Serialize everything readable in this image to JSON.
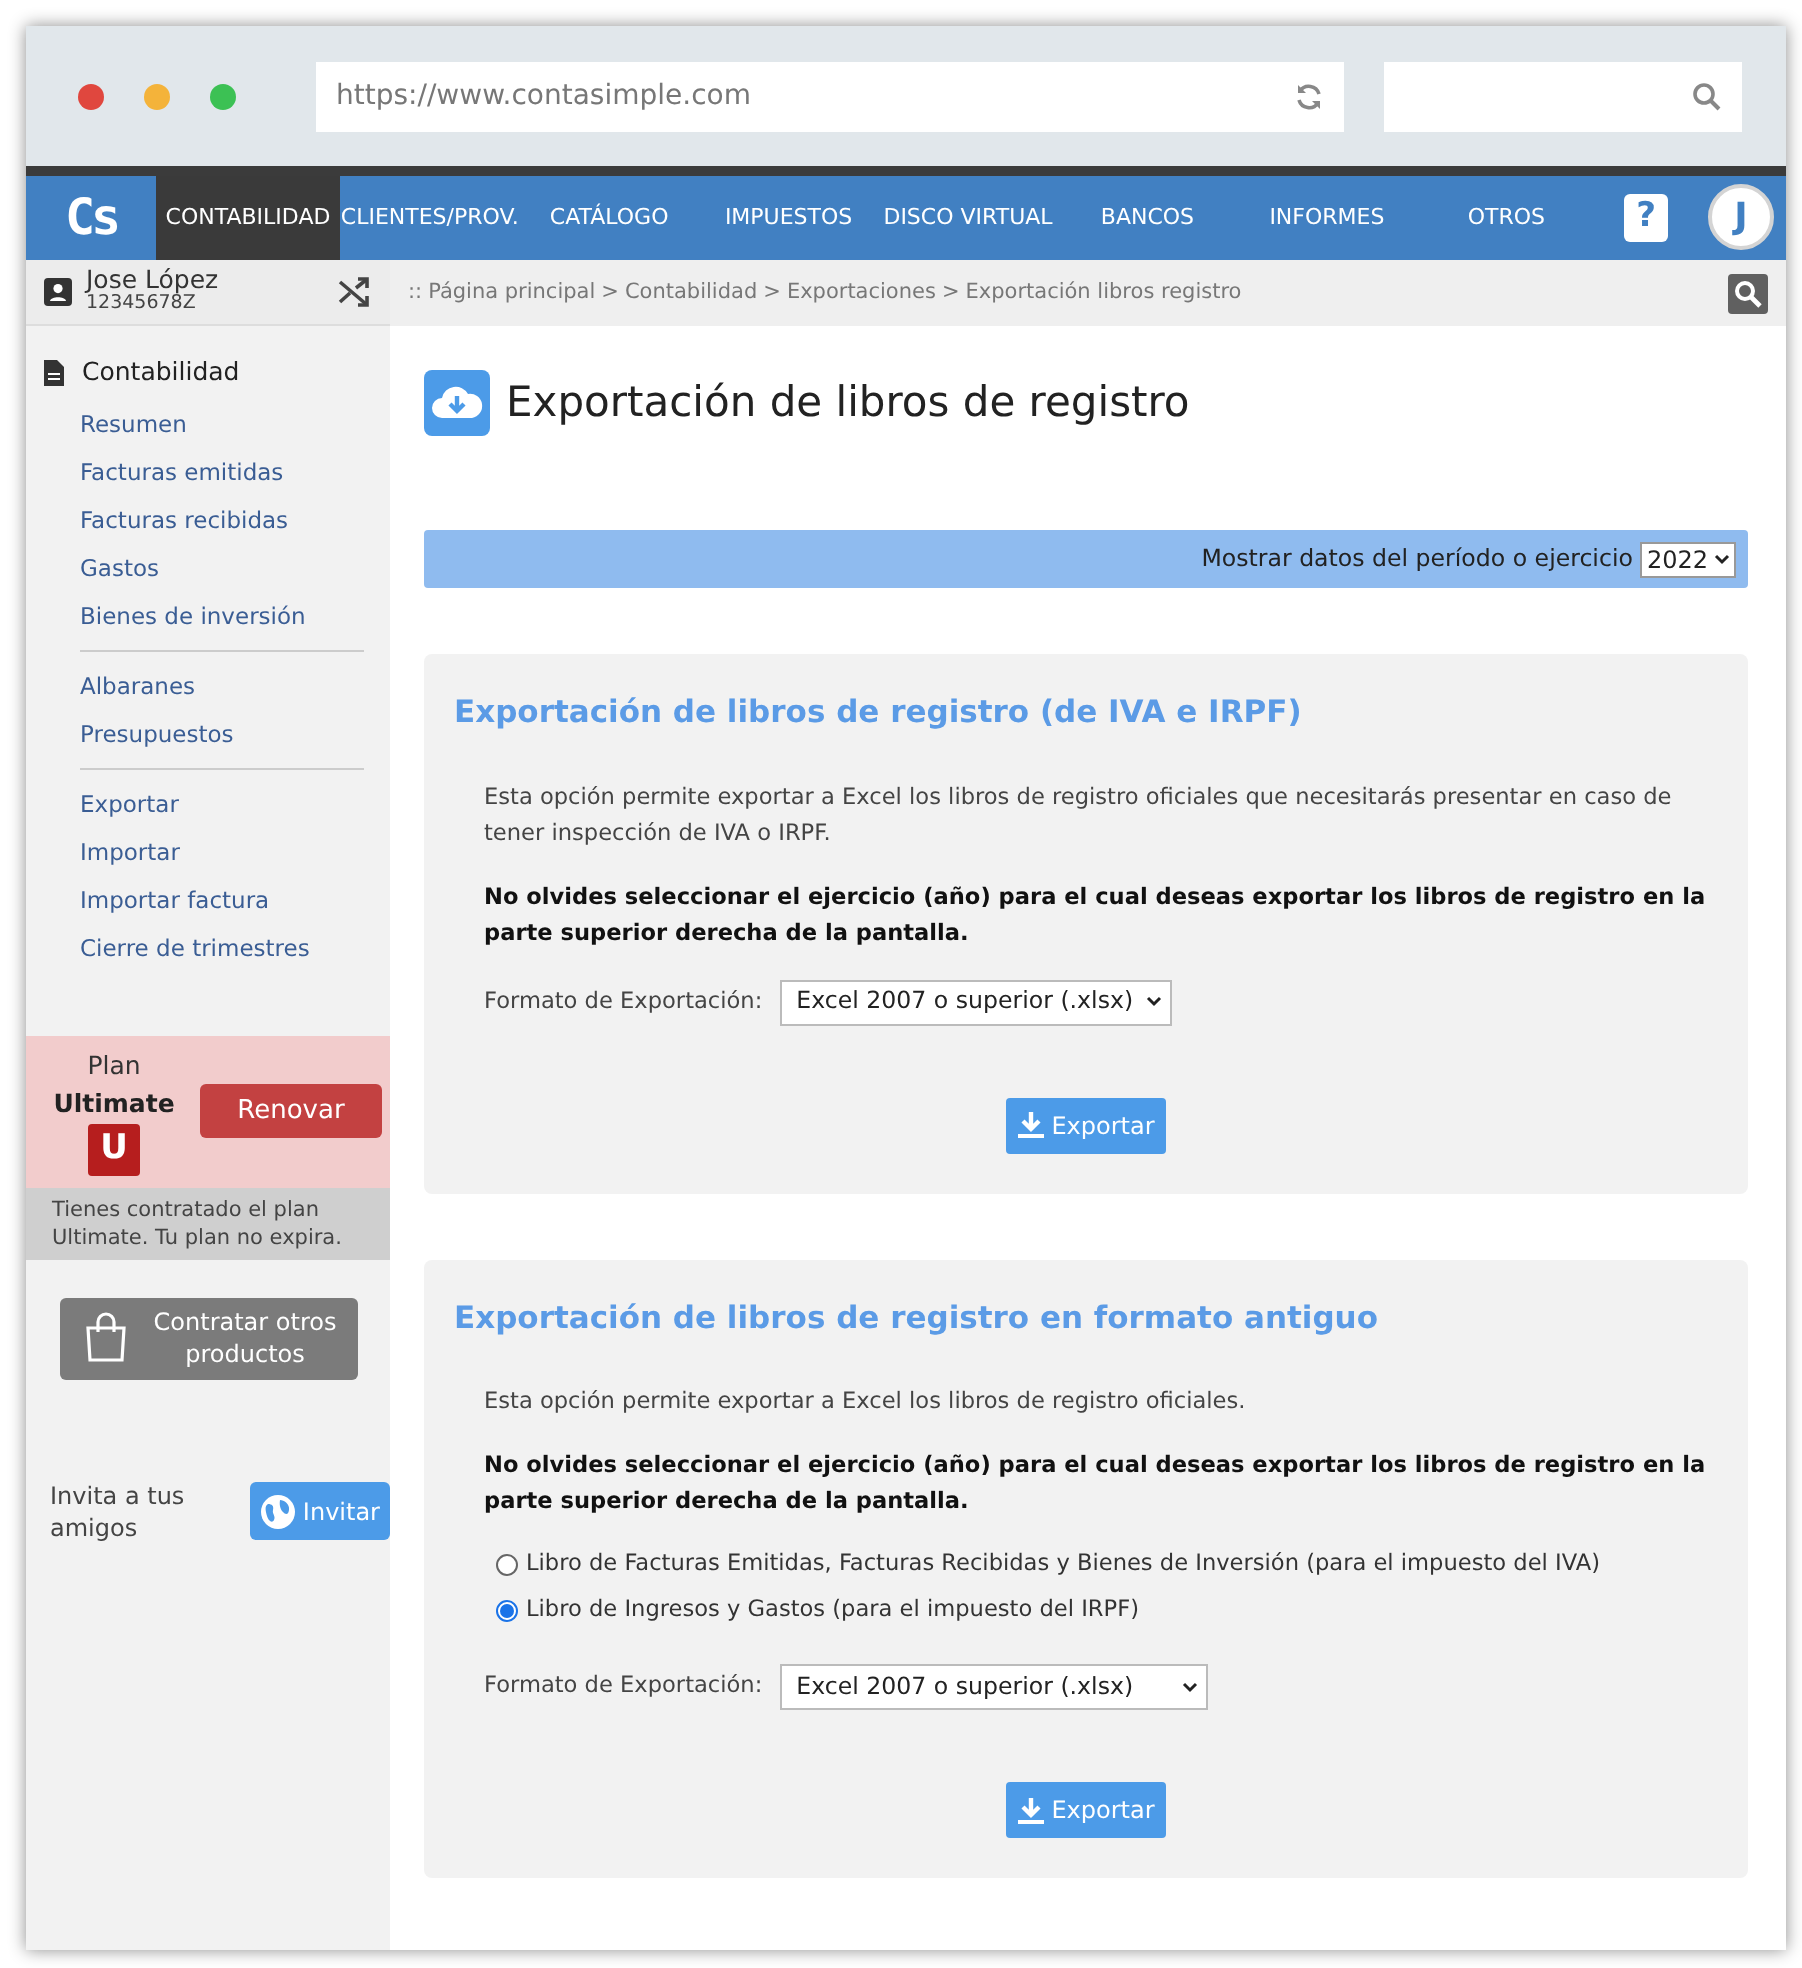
{
  "browser": {
    "url": "https://www.contasimple.com"
  },
  "nav": {
    "logo": "Cs",
    "items": [
      {
        "label": "CONTABILIDAD",
        "selected": true
      },
      {
        "label": "CLIENTES/PROV.",
        "selected": false
      },
      {
        "label": "CATÁLOGO",
        "selected": false
      },
      {
        "label": "IMPUESTOS",
        "selected": false
      },
      {
        "label": "DISCO VIRTUAL",
        "selected": false
      },
      {
        "label": "BANCOS",
        "selected": false
      },
      {
        "label": "INFORMES",
        "selected": false
      },
      {
        "label": "OTROS",
        "selected": false
      }
    ],
    "help": "?",
    "avatar": "J"
  },
  "user": {
    "name": "Jose López",
    "id": "12345678Z"
  },
  "sidebar": {
    "section": "Contabilidad",
    "groups": [
      [
        "Resumen",
        "Facturas emitidas",
        "Facturas recibidas",
        "Gastos",
        "Bienes de inversión"
      ],
      [
        "Albaranes",
        "Presupuestos"
      ],
      [
        "Exportar",
        "Importar",
        "Importar factura",
        "Cierre de trimestres"
      ]
    ]
  },
  "plan": {
    "label": "Plan",
    "name": "Ultimate",
    "badge": "U",
    "renew": "Renovar",
    "note": "Tienes contratado el plan Ultimate. Tu plan no expira."
  },
  "contract_button": "Contratar otros productos",
  "invite": {
    "text": "Invita a tus amigos",
    "button": "Invitar"
  },
  "breadcrumb": {
    "prefix": "::",
    "links": [
      "Página principal",
      "Contabilidad",
      "Exportaciones"
    ],
    "separators": [
      ">",
      ">",
      ">"
    ],
    "current": "Exportación libros registro"
  },
  "page_title": "Exportación de libros de registro",
  "period": {
    "label": "Mostrar datos del período o ejercicio",
    "year": "2022"
  },
  "sections": [
    {
      "title": "Exportación de libros de registro (de IVA e IRPF)",
      "paragraphs": [
        {
          "text": "Esta opción permite exportar a Excel los libros de registro oficiales que necesitarás presentar en caso de tener inspección de IVA o IRPF.",
          "bold": false
        },
        {
          "text": "No olvides seleccionar el ejercicio (año) para el cual deseas exportar los libros de registro en la parte superior derecha de la pantalla.",
          "bold": true
        }
      ],
      "format_label": "Formato de Exportación:",
      "format_value": "Excel 2007 o superior (.xlsx)",
      "button": "Exportar"
    },
    {
      "title": "Exportación de libros de registro en formato antiguo",
      "paragraphs": [
        {
          "text": "Esta opción permite exportar a Excel los libros de registro oficiales.",
          "bold": false
        },
        {
          "text": "No olvides seleccionar el ejercicio (año) para el cual deseas exportar los libros de registro en la parte superior derecha de la pantalla.",
          "bold": true
        }
      ],
      "options": [
        {
          "label": "Libro de Facturas Emitidas, Facturas Recibidas y Bienes de Inversión (para el impuesto del IVA)",
          "selected": false
        },
        {
          "label": "Libro de Ingresos y Gastos (para el impuesto del IRPF)",
          "selected": true
        }
      ],
      "format_label": "Formato de Exportación:",
      "format_value": "Excel 2007 o superior (.xlsx)",
      "button": "Exportar"
    }
  ]
}
